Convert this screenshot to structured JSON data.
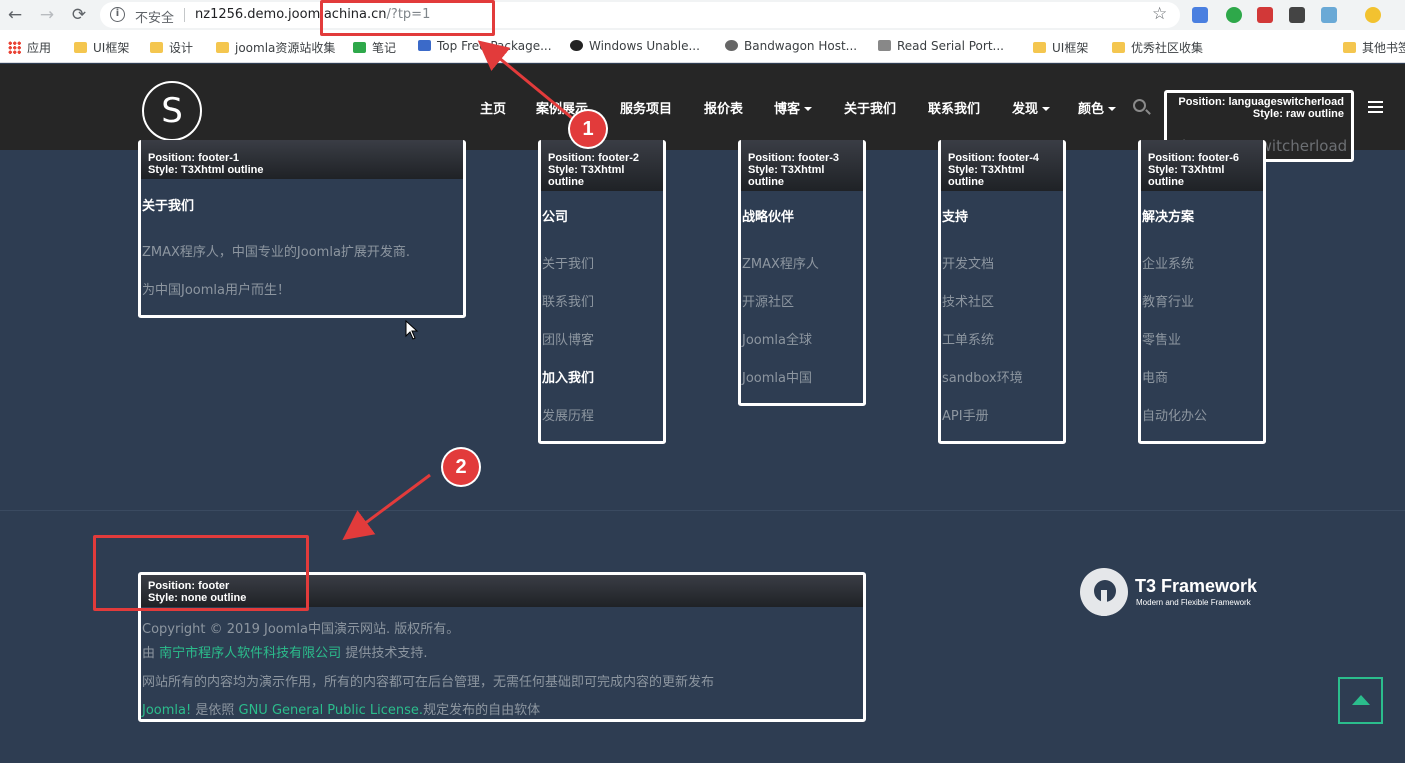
{
  "browser": {
    "back_icon": "←",
    "forward_icon": "→",
    "reload_icon": "⟳",
    "insecure_label": "不安全",
    "url_host": "nz1256.demo.joomlachina.cn",
    "url_path": "/?tp=1",
    "star_icon": "☆"
  },
  "bookmarks": [
    "应用",
    "UI框架",
    "设计",
    "joomla资源站收集",
    "笔记",
    "Top Free Package...",
    "Windows Unable...",
    "Bandwagon Host...",
    "Read Serial Port...",
    "UI框架",
    "优秀社区收集",
    "其他书签"
  ],
  "site": {
    "logo_letter": "S",
    "menu": [
      "主页",
      "案例展示",
      "服务项目",
      "报价表",
      "博客",
      "关于我们",
      "联系我们",
      "发现",
      "颜色"
    ]
  },
  "langswitch": {
    "line1": "Position: languageswitcherload",
    "line2": "Style: raw outline",
    "content": "languageswitcherload"
  },
  "footer1": {
    "line1": "Position: footer-1",
    "line2": "Style: T3Xhtml outline",
    "title": "关于我们",
    "text1": "ZMAX程序人，中国专业的Joomla扩展开发商.",
    "text2": "为中国Joomla用户而生！"
  },
  "footer2": {
    "line1": "Position: footer-2",
    "line2": "Style: T3Xhtml",
    "line3": "outline",
    "title": "公司",
    "items": [
      "关于我们",
      "联系我们",
      "团队博客",
      "加入我们",
      "发展历程"
    ]
  },
  "footer3": {
    "line1": "Position: footer-3",
    "line2": "Style: T3Xhtml",
    "line3": "outline",
    "title": "战略伙伴",
    "items": [
      "ZMAX程序人",
      "开源社区",
      "Joomla全球",
      "Joomla中国"
    ]
  },
  "footer4": {
    "line1": "Position: footer-4",
    "line2": "Style: T3Xhtml",
    "line3": "outline",
    "title": "支持",
    "items": [
      "开发文档",
      "技术社区",
      "工单系统",
      "sandbox环境",
      "API手册"
    ]
  },
  "footer6": {
    "line1": "Position: footer-6",
    "line2": "Style: T3Xhtml",
    "line3": "outline",
    "title": "解决方案",
    "items": [
      "企业系统",
      "教育行业",
      "零售业",
      "电商",
      "自动化办公"
    ]
  },
  "footer": {
    "line1": "Position: footer",
    "line2": "Style: none outline",
    "copyright": "Copyright © 2019 Joomla中国演示网站. 版权所有。",
    "support_pre": "由",
    "support_link": "南宁市程序人软件科技有限公司",
    "support_post": "提供技术支持.",
    "notice": "网站所有的内容均为演示作用，所有的内容都可在后台管理，无需任何基础即可完成内容的更新发布",
    "joomla_link": "Joomla!",
    "license_pre": "是依照",
    "license_link": "GNU General Public License.",
    "license_post": "规定发布的自由软体"
  },
  "t3": {
    "name": "T3 Framework",
    "tagline": "Modern and Flexible Framework"
  },
  "annotations": {
    "badge1": "1",
    "badge2": "2"
  },
  "colors": {
    "accent": "#2bbd8c",
    "annotation_red": "#e23b3b",
    "page_bg": "#2e3d52",
    "header_bg": "#262626"
  }
}
